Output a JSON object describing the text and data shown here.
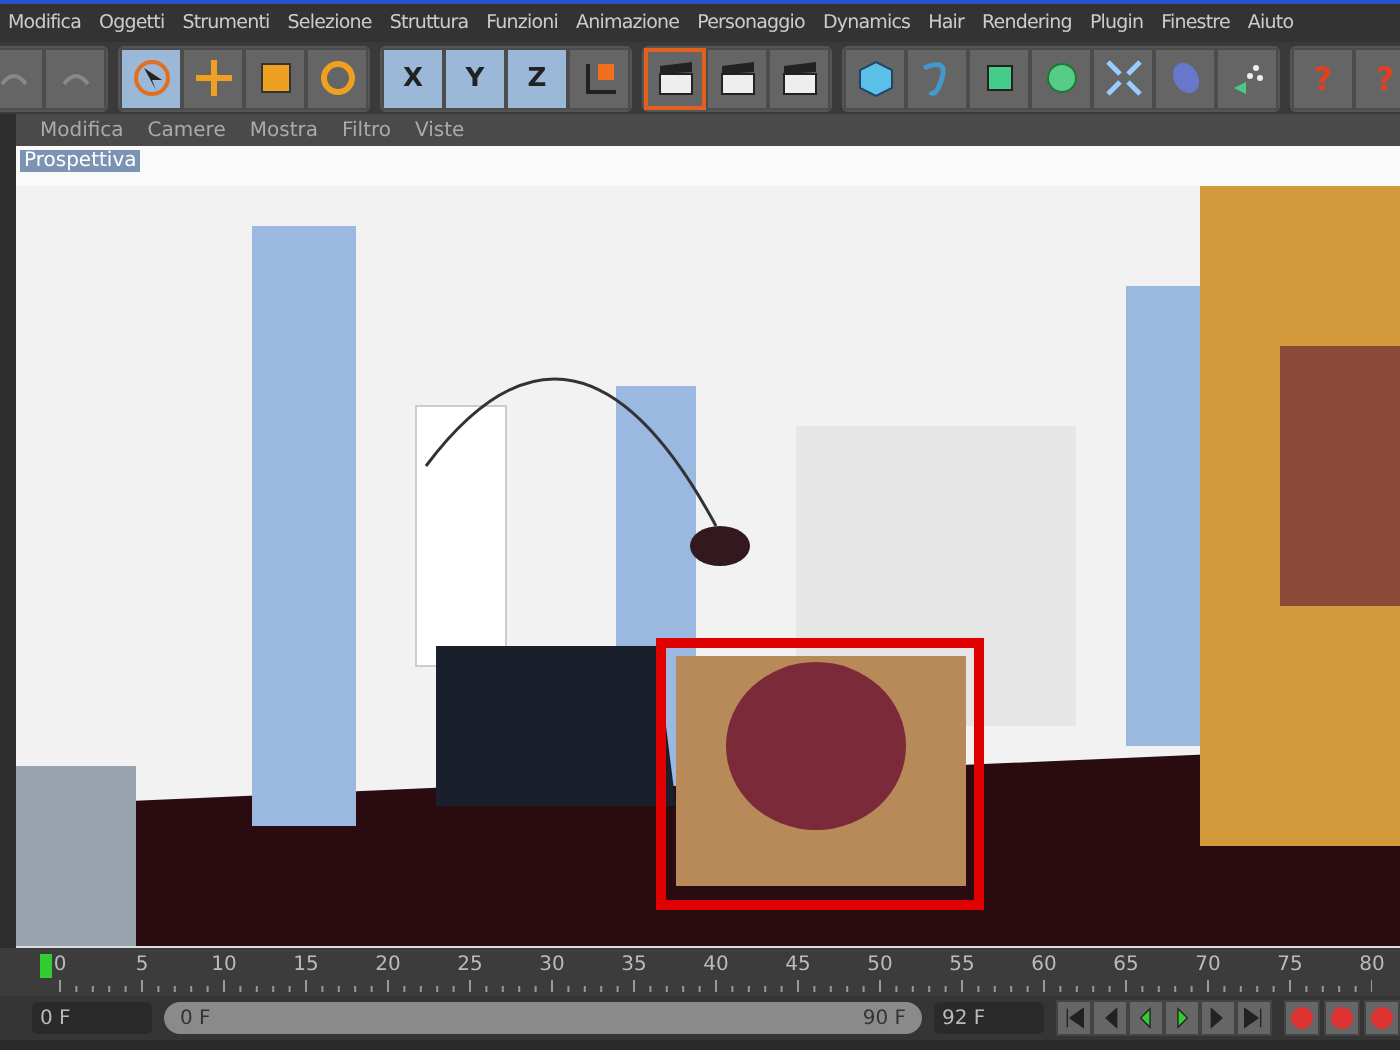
{
  "menu": [
    "Modifica",
    "Oggetti",
    "Strumenti",
    "Selezione",
    "Struttura",
    "Funzioni",
    "Animazione",
    "Personaggio",
    "Dynamics",
    "Hair",
    "Rendering",
    "Plugin",
    "Finestre",
    "Aiuto"
  ],
  "toolbar": [
    {
      "kind": "history",
      "tools": [
        {
          "kind": "undo",
          "selected": false
        },
        {
          "kind": "redo",
          "selected": false
        }
      ]
    },
    {
      "kind": "edit",
      "tools": [
        {
          "kind": "select",
          "selected": true
        },
        {
          "kind": "move",
          "selected": false
        },
        {
          "kind": "scale",
          "selected": false
        },
        {
          "kind": "rotate",
          "selected": false
        }
      ]
    },
    {
      "kind": "axis",
      "tools": [
        {
          "kind": "axis",
          "label": "X",
          "selected": true
        },
        {
          "kind": "axis",
          "label": "Y",
          "selected": true
        },
        {
          "kind": "axis",
          "label": "Z",
          "selected": true
        },
        {
          "kind": "coords",
          "selected": false
        }
      ]
    },
    {
      "kind": "render",
      "tools": [
        {
          "kind": "clapper",
          "selected": true
        },
        {
          "kind": "clapper",
          "selected": false
        },
        {
          "kind": "clapper",
          "selected": false
        }
      ]
    },
    {
      "kind": "objects",
      "tools": [
        {
          "kind": "cube",
          "selected": false
        },
        {
          "kind": "spline",
          "selected": false
        },
        {
          "kind": "nurbs",
          "selected": false
        },
        {
          "kind": "array",
          "selected": false
        },
        {
          "kind": "deformer",
          "selected": false
        },
        {
          "kind": "scene",
          "selected": false
        },
        {
          "kind": "particles",
          "selected": false
        }
      ]
    },
    {
      "kind": "help",
      "tools": [
        {
          "kind": "help",
          "label": "?",
          "selected": false
        },
        {
          "kind": "calendar",
          "label": "?",
          "selected": false
        }
      ]
    }
  ],
  "viewport": {
    "menu": [
      "Modifica",
      "Camere",
      "Mostra",
      "Filtro",
      "Viste"
    ],
    "camera": "Prospettiva",
    "highlight": true
  },
  "timeline": {
    "ticks": [
      "0",
      "5",
      "10",
      "15",
      "20",
      "25",
      "30",
      "35",
      "40",
      "45",
      "50",
      "55",
      "60",
      "65",
      "70",
      "75",
      "80"
    ],
    "playhead": {
      "level": 0
    }
  },
  "controls": {
    "current_frame": "0 F",
    "range_start": "0 F",
    "range_end": "90 F",
    "end_frame": "92 F",
    "range": {
      "level": 1
    }
  }
}
